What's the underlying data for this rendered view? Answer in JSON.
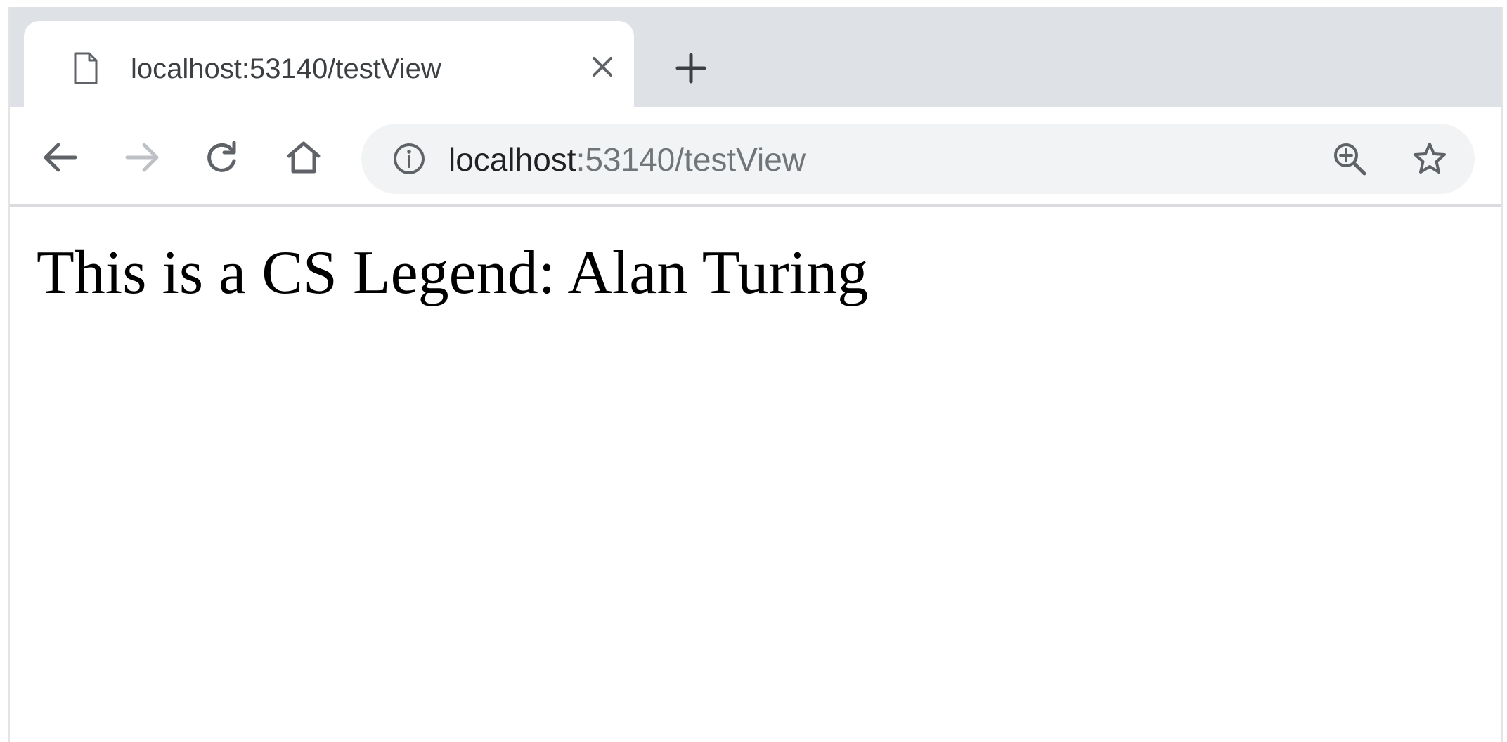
{
  "browser": {
    "tab": {
      "title": "localhost:53140/testView"
    },
    "omnibox": {
      "url_host": "localhost",
      "url_rest": ":53140/testView"
    },
    "icons": {
      "tab_page": "document-icon",
      "tab_close": "close-icon",
      "new_tab": "plus-icon",
      "back": "arrow-left-icon",
      "forward": "arrow-right-icon",
      "reload": "reload-icon",
      "home": "home-icon",
      "site_info": "info-icon",
      "zoom": "zoom-in-icon",
      "bookmark": "star-icon"
    },
    "colors": {
      "tab_strip": "#dee1e6",
      "omnibox_bg": "#f1f3f4",
      "icon_active": "#5f6368",
      "icon_disabled": "#bdc1c6"
    }
  },
  "page": {
    "heading": "This is a CS Legend: Alan Turing"
  }
}
